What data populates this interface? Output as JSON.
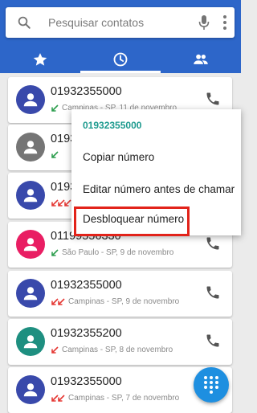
{
  "search": {
    "placeholder": "Pesquisar contatos"
  },
  "tabs": [
    {
      "icon": "star-icon",
      "label": "",
      "active": false
    },
    {
      "icon": "clock-icon",
      "label": "",
      "active": true
    },
    {
      "icon": "people-icon",
      "label": "",
      "active": false
    }
  ],
  "calls": [
    {
      "number": "01932355000",
      "location": "Campinas - SP, 11 de novembro",
      "type": "incoming",
      "avatar_color": "#3949ab"
    },
    {
      "number": "01932355000",
      "location": "",
      "type": "incoming",
      "avatar_color": "#757575"
    },
    {
      "number": "01932355000",
      "location": "",
      "type": "missed-multiple",
      "avatar_color": "#3949ab"
    },
    {
      "number": "01199556330",
      "location": "São Paulo - SP, 9 de novembro",
      "type": "incoming",
      "avatar_color": "#e91e63"
    },
    {
      "number": "01932355000",
      "location": "Campinas - SP, 9 de novembro",
      "type": "missed-multiple",
      "avatar_color": "#3949ab"
    },
    {
      "number": "01932355200",
      "location": "Campinas - SP, 8 de novembro",
      "type": "missed",
      "avatar_color": "#1e8f80"
    },
    {
      "number": "01932355000",
      "location": "Campinas - SP, 7 de novembro",
      "type": "missed-multiple",
      "avatar_color": "#3949ab"
    }
  ],
  "context_menu": {
    "title": "01932355000",
    "items": [
      "Copiar número",
      "Editar número antes de chamar",
      "Desbloquear número"
    ],
    "highlighted_item": "Desbloquear número"
  },
  "colors": {
    "appbar": "#2d66c9",
    "fab": "#1e8fe0",
    "accent": "#1d9a8e",
    "highlight": "#e2231a",
    "missed": "#e53935",
    "incoming": "#2e9e4f"
  }
}
